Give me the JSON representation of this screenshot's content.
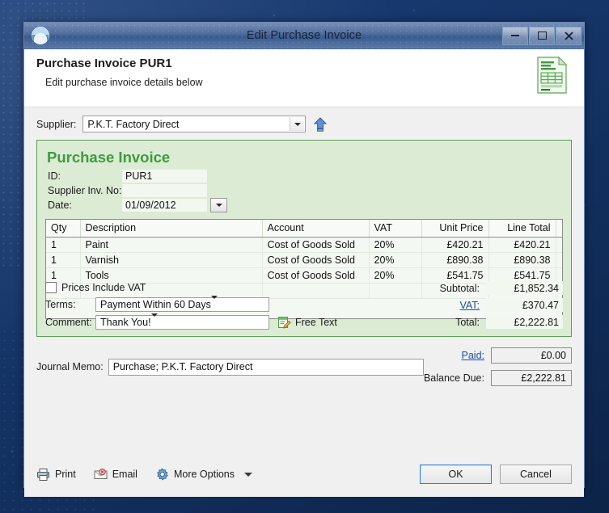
{
  "window": {
    "title": "Edit Purchase Invoice",
    "icon": "app-globe-icon",
    "minimize_label": "Minimize",
    "maximize_label": "Maximize",
    "close_label": "Close"
  },
  "header": {
    "title": "Purchase Invoice PUR1",
    "subtitle": "Edit purchase invoice details below",
    "icon": "invoice-document-icon"
  },
  "supplier": {
    "label": "Supplier:",
    "value": "P.K.T. Factory Direct",
    "goto_icon": "go-to-supplier-icon"
  },
  "invoice": {
    "panel_title": "Purchase Invoice",
    "id_label": "ID:",
    "id_value": "PUR1",
    "supplier_inv_label": "Supplier Inv. No:",
    "supplier_inv_value": "",
    "date_label": "Date:",
    "date_value": "01/09/2012",
    "date_picker_icon": "calendar-dropdown-icon"
  },
  "items_table": {
    "columns": [
      "Qty",
      "Description",
      "Account",
      "VAT",
      "Unit Price",
      "Line Total"
    ],
    "rows": [
      {
        "qty": "1",
        "description": "Paint",
        "account": "Cost of Goods Sold",
        "vat": "20%",
        "unit_price": "£420.21",
        "line_total": "£420.21"
      },
      {
        "qty": "1",
        "description": "Varnish",
        "account": "Cost of Goods Sold",
        "vat": "20%",
        "unit_price": "£890.38",
        "line_total": "£890.38"
      },
      {
        "qty": "1",
        "description": "Tools",
        "account": "Cost of Goods Sold",
        "vat": "20%",
        "unit_price": "£541.75",
        "line_total": "£541.75"
      },
      {
        "qty": "",
        "description": "",
        "account": "",
        "vat": "",
        "unit_price": "",
        "line_total": ""
      }
    ]
  },
  "options": {
    "prices_include_vat_label": "Prices Include VAT",
    "prices_include_vat_checked": false,
    "terms_label": "Terms:",
    "terms_value": "Payment Within 60 Days",
    "comment_label": "Comment:",
    "comment_value": "Thank You!",
    "free_text_label": "Free Text",
    "free_text_icon": "free-text-note-icon"
  },
  "totals": {
    "subtotal_label": "Subtotal:",
    "subtotal_value": "£1,852.34",
    "vat_label": "VAT:",
    "vat_value": "£370.47",
    "total_label": "Total:",
    "total_value": "£2,222.81"
  },
  "memo": {
    "label": "Journal Memo:",
    "value": "Purchase; P.K.T. Factory Direct"
  },
  "payment": {
    "paid_label": "Paid:",
    "paid_value": "£0.00",
    "balance_label": "Balance Due:",
    "balance_value": "£2,222.81"
  },
  "toolbar": {
    "print_label": "Print",
    "print_icon": "printer-icon",
    "email_label": "Email",
    "email_icon": "email-envelope-icon",
    "more_options_label": "More Options",
    "more_options_icon": "gear-icon"
  },
  "dialog_buttons": {
    "ok_label": "OK",
    "cancel_label": "Cancel"
  },
  "colors": {
    "panel_bg": "#dcebd4",
    "panel_border": "#5a9e53",
    "panel_title": "#3f9a3f",
    "link": "#1a4ea8",
    "titlebar": "#2e5088",
    "default_button_border": "#2a7fd4"
  }
}
